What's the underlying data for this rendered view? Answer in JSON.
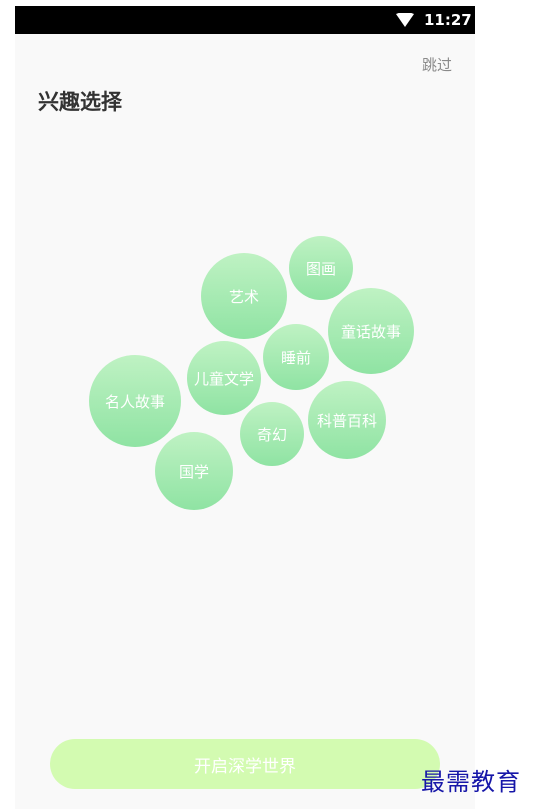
{
  "status_bar": {
    "time": "11:27",
    "wifi_icon": "wifi-icon"
  },
  "header": {
    "skip_label": "跳过",
    "title": "兴趣选择"
  },
  "interests": [
    {
      "id": "yishu",
      "label": "艺术"
    },
    {
      "id": "tuhua",
      "label": "图画"
    },
    {
      "id": "tonghuagushi",
      "label": "童话故事"
    },
    {
      "id": "shuiqian",
      "label": "睡前"
    },
    {
      "id": "ertongwenxue",
      "label": "儿童文学"
    },
    {
      "id": "mingrengushi",
      "label": "名人故事"
    },
    {
      "id": "kepubaike",
      "label": "科普百科"
    },
    {
      "id": "qihuan",
      "label": "奇幻"
    },
    {
      "id": "guoxue",
      "label": "国学"
    }
  ],
  "footer": {
    "start_label": "开启深学世界"
  },
  "watermark": "最需教育",
  "colors": {
    "bubble_top": "#bff2c3",
    "bubble_bottom": "#8fe3a3",
    "start_button": "#d3fbb1",
    "watermark": "#1616a8"
  }
}
